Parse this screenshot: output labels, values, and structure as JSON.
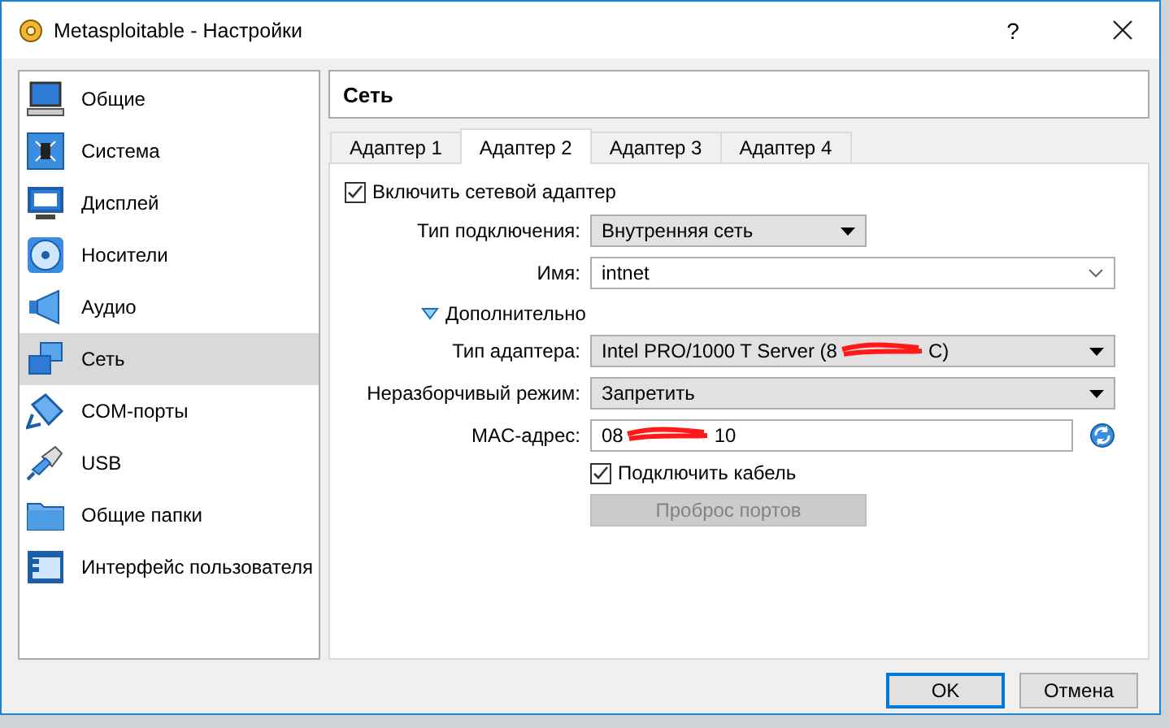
{
  "window": {
    "title": "Metasploitable - Настройки",
    "help": "?"
  },
  "sidebar": {
    "items": [
      {
        "label": "Общие",
        "selected": false
      },
      {
        "label": "Система",
        "selected": false
      },
      {
        "label": "Дисплей",
        "selected": false
      },
      {
        "label": "Носители",
        "selected": false
      },
      {
        "label": "Аудио",
        "selected": false
      },
      {
        "label": "Сеть",
        "selected": true
      },
      {
        "label": "COM-порты",
        "selected": false
      },
      {
        "label": "USB",
        "selected": false
      },
      {
        "label": "Общие папки",
        "selected": false
      },
      {
        "label": "Интерфейс пользователя",
        "selected": false
      }
    ]
  },
  "panel": {
    "title": "Сеть",
    "tabs": [
      {
        "label": "Адаптер 1",
        "selected": false
      },
      {
        "label": "Адаптер 2",
        "selected": true
      },
      {
        "label": "Адаптер 3",
        "selected": false
      },
      {
        "label": "Адаптер 4",
        "selected": false
      }
    ],
    "enable_adapter": {
      "label": "Включить сетевой адаптер",
      "checked": true
    },
    "fields": [
      {
        "kind": "dropdown",
        "label": "Тип подключения:",
        "value": "Внутренняя сеть"
      },
      {
        "kind": "combo",
        "label": "Имя:",
        "value": "intnet"
      }
    ],
    "advanced": {
      "label": "Дополнительно",
      "expanded": true
    },
    "advanced_fields": [
      {
        "kind": "dropdown-wide",
        "label": "Тип адаптера:",
        "value": "Intel PRO/1000 T Server (8",
        "redacted": true,
        "value_after_redaction": "C)"
      },
      {
        "kind": "dropdown-wide",
        "label": "Неразборчивый режим:",
        "value": "Запретить",
        "redacted": false
      },
      {
        "kind": "mac",
        "label": "MAC-адрес:",
        "value": "08",
        "redacted": true,
        "value_after_redaction": "10"
      }
    ],
    "cable": {
      "label": "Подключить кабель",
      "checked": true
    },
    "port_forwarding": {
      "label": "Проброс портов",
      "disabled": true
    }
  },
  "buttons": [
    {
      "label": "OK",
      "default": true
    },
    {
      "label": "Отмена",
      "default": false
    }
  ]
}
